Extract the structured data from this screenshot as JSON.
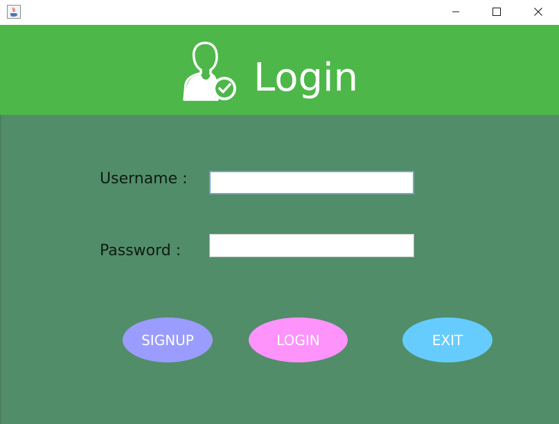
{
  "window": {
    "controls": {
      "minimize_icon": "minimize-icon",
      "maximize_icon": "maximize-icon",
      "close_icon": "close-icon"
    },
    "app_icon": "java-app-icon"
  },
  "header": {
    "title": "Login",
    "icon": "user-check-icon",
    "background": "#4db749"
  },
  "form": {
    "background": "#518d69",
    "username_label": "Username :",
    "username_value": "",
    "password_label": "Password :",
    "password_value": ""
  },
  "buttons": {
    "signup_label": "SIGNUP",
    "signup_color": "#9a9cff",
    "login_label": "LOGIN",
    "login_color": "#fe93fc",
    "exit_label": "EXIT",
    "exit_color": "#66ccfe"
  }
}
